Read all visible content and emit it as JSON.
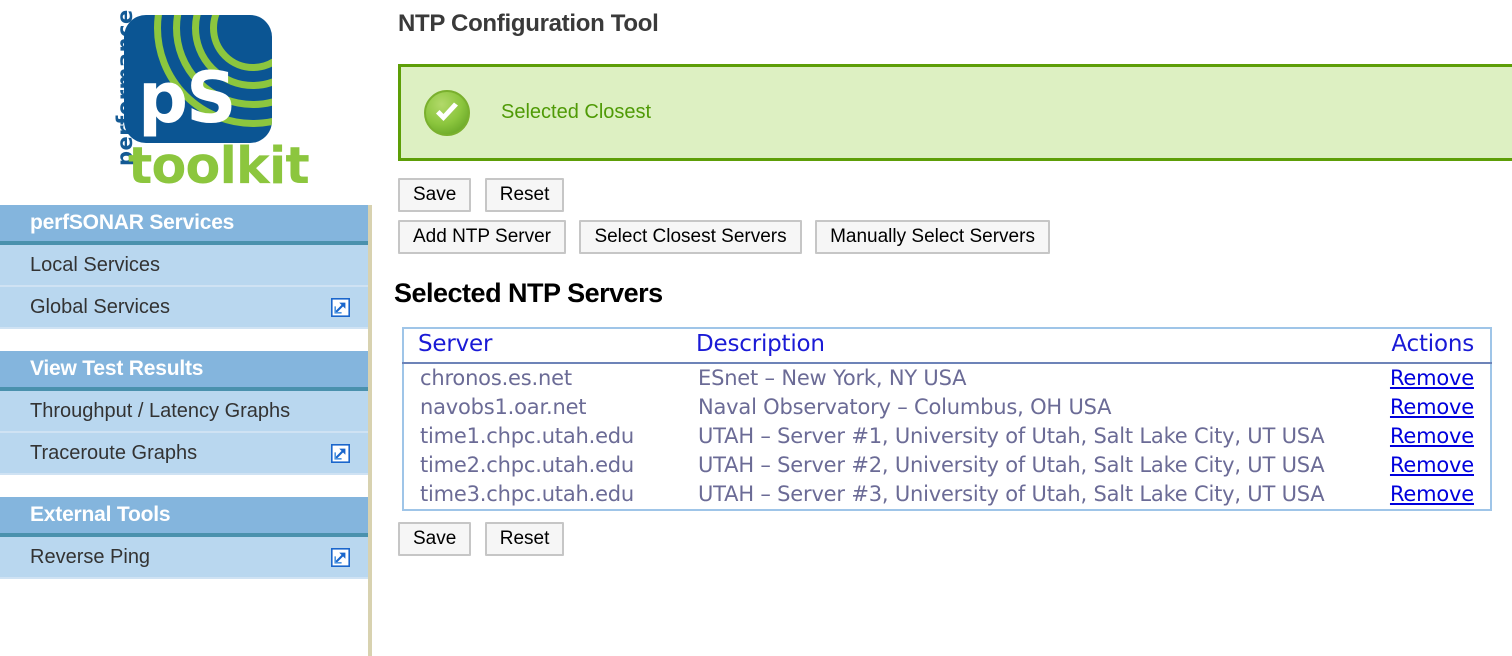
{
  "sidebar": {
    "logo": {
      "performance": "performance",
      "ps": "pS",
      "toolkit": "toolkit"
    },
    "groups": [
      {
        "title": "perfSONAR Services",
        "items": [
          {
            "label": "Local Services",
            "external": false
          },
          {
            "label": "Global Services",
            "external": true
          }
        ]
      },
      {
        "title": "View Test Results",
        "items": [
          {
            "label": "Throughput / Latency Graphs",
            "external": false
          },
          {
            "label": "Traceroute Graphs",
            "external": true
          }
        ]
      },
      {
        "title": "External Tools",
        "items": [
          {
            "label": "Reverse Ping",
            "external": true
          }
        ]
      }
    ]
  },
  "main": {
    "page_title": "NTP Configuration Tool",
    "alert": {
      "icon": "success-check-icon",
      "message": "Selected Closest",
      "background_color": "#ddf0c2",
      "border_color": "#5d9e07",
      "text_color": "#4f9a06"
    },
    "buttons_top": [
      {
        "label": "Save",
        "name": "save-button-top"
      },
      {
        "label": "Reset",
        "name": "reset-button-top"
      }
    ],
    "buttons_actions": [
      {
        "label": "Add NTP Server",
        "name": "add-ntp-server-button"
      },
      {
        "label": "Select Closest Servers",
        "name": "select-closest-servers-button"
      },
      {
        "label": "Manually Select Servers",
        "name": "manually-select-servers-button"
      }
    ],
    "section_title": "Selected NTP Servers",
    "table": {
      "columns": [
        "Server",
        "Description",
        "Actions"
      ],
      "action_label": "Remove",
      "rows": [
        {
          "server": "chronos.es.net",
          "description": "ESnet – New York, NY USA",
          "action": "Remove"
        },
        {
          "server": "navobs1.oar.net",
          "description": "Naval Observatory – Columbus, OH USA",
          "action": "Remove"
        },
        {
          "server": "time1.chpc.utah.edu",
          "description": "UTAH – Server #1, University of Utah, Salt Lake City, UT USA",
          "action": "Remove"
        },
        {
          "server": "time2.chpc.utah.edu",
          "description": "UTAH – Server #2, University of Utah, Salt Lake City, UT USA",
          "action": "Remove"
        },
        {
          "server": "time3.chpc.utah.edu",
          "description": "UTAH – Server #3, University of Utah, Salt Lake City, UT USA",
          "action": "Remove"
        }
      ]
    },
    "buttons_bottom": [
      {
        "label": "Save",
        "name": "save-button-bottom"
      },
      {
        "label": "Reset",
        "name": "reset-button-bottom"
      }
    ]
  }
}
